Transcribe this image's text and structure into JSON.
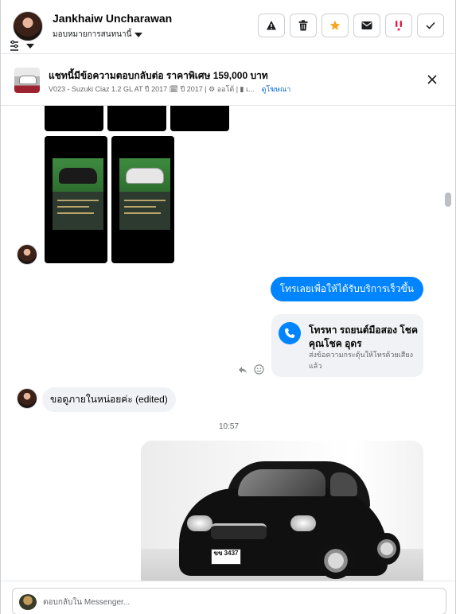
{
  "header": {
    "contact_name": "Jankhaiw Uncharawan",
    "assign_label": "มอบหมายการสนทนานี้",
    "actions": [
      {
        "name": "report-button",
        "icon": "warning-icon"
      },
      {
        "name": "delete-button",
        "icon": "trash-icon"
      },
      {
        "name": "star-button",
        "icon": "star-icon",
        "color": "#f5a623"
      },
      {
        "name": "mark-unread-button",
        "icon": "envelope-icon"
      },
      {
        "name": "spam-button",
        "icon": "spam-exclamation-icon",
        "color": "#e41e3f"
      },
      {
        "name": "mark-done-button",
        "icon": "check-icon"
      }
    ]
  },
  "listing": {
    "title": "แชทนี้มีข้อความตอบกลับต่อ ราคาพิเศษ 159,000 บาท",
    "subtitle": "V023 - Suzuki Ciaz 1.2 GL AT ปี 2017 🗓 ปี 2017 | ⚙ ออโต้ | ▮ เ...",
    "view_link": "ดูโฆษณา"
  },
  "messages": {
    "outgoing_text": "โทรเลยเพื่อให้ได้รับบริการเร็วขึ้น",
    "call_card_title": "โทรหา รถยนต์มือสอง โชคคุณโชค อุดร",
    "call_card_subtitle": "ส่งข้อความกระตุ้นให้โทรด้วยเสียงแล้ว",
    "incoming_text": "ขอดูภายในหน่อยค่ะ (edited)",
    "timestamp": "10:57",
    "photo_plate": "ขข 3437"
  },
  "composer": {
    "placeholder": "ตอบกลับใน Messenger..."
  }
}
